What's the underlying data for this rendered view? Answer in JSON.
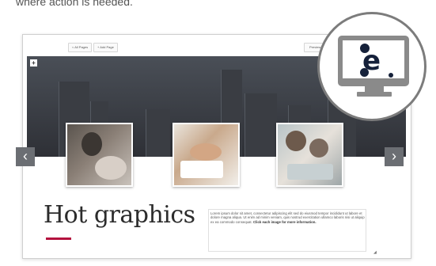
{
  "intro_text": "where action is needed.",
  "toolbar": {
    "all_pages_label": "< All Pages",
    "add_page_label": "+ Add Page",
    "right_button_label": "Preview"
  },
  "editor": {
    "add_button_label": "+",
    "heading": "Hot graphics",
    "body_text": "Lorem ipsum dolor sit amet, consectetur adipiscing elit sed do eiusmod tempor incididunt ut labore et dolore magna aliqua. Ut enim ad minim veniam, quis nostrud exercitation ullamco laboris nisi ut aliquip ex ea commodo consequat.",
    "cta_text": "Click each image for more information.",
    "accent_color": "#b4123e"
  },
  "carousel": {
    "prev_label": "‹",
    "next_label": "›"
  },
  "icons": [
    "elucidat-logo-icon",
    "monitor-icon",
    "chevron-left-icon",
    "chevron-right-icon",
    "plus-icon",
    "resize-handle-icon"
  ]
}
